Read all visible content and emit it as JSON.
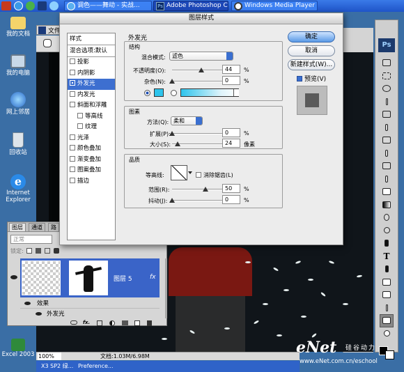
{
  "taskbar": {
    "tabs": [
      {
        "label": "调色——舞动 - 实战..."
      },
      {
        "label": "Adobe Photoshop C..."
      },
      {
        "label": "Windows Media Player"
      }
    ],
    "tray_items": [
      {
        "label": "X3 SP2 绿..."
      },
      {
        "label": "Preference..."
      }
    ]
  },
  "desktop": {
    "icons": [
      {
        "label": "我的文档"
      },
      {
        "label": "我的电脑"
      },
      {
        "label": "网上邻居"
      },
      {
        "label": "回收站"
      },
      {
        "label": "Internet Explorer"
      },
      {
        "label": "Excel 2003"
      }
    ]
  },
  "photoshop": {
    "menu_file": "文件",
    "zoom": "100%",
    "doc_info": "文档:1.03M/6.98M",
    "toolbox_title": "Ps"
  },
  "dialog": {
    "title": "图层样式",
    "styles_panel": {
      "header": "样式",
      "blend_options": "混合选项:默认",
      "items": [
        {
          "label": "投影",
          "checked": false,
          "selected": false,
          "indent": false
        },
        {
          "label": "内阴影",
          "checked": false,
          "selected": false,
          "indent": false
        },
        {
          "label": "外发光",
          "checked": true,
          "selected": true,
          "indent": false
        },
        {
          "label": "内发光",
          "checked": false,
          "selected": false,
          "indent": false
        },
        {
          "label": "斜面和浮雕",
          "checked": false,
          "selected": false,
          "indent": false
        },
        {
          "label": "等高线",
          "checked": false,
          "selected": false,
          "indent": true
        },
        {
          "label": "纹理",
          "checked": false,
          "selected": false,
          "indent": true
        },
        {
          "label": "光泽",
          "checked": false,
          "selected": false,
          "indent": false
        },
        {
          "label": "颜色叠加",
          "checked": false,
          "selected": false,
          "indent": false
        },
        {
          "label": "渐变叠加",
          "checked": false,
          "selected": false,
          "indent": false
        },
        {
          "label": "图案叠加",
          "checked": false,
          "selected": false,
          "indent": false
        },
        {
          "label": "描边",
          "checked": false,
          "selected": false,
          "indent": false
        }
      ]
    },
    "outer_glow": {
      "title": "外发光",
      "structure": {
        "title": "结构",
        "blend_mode_label": "混合模式:",
        "blend_mode_value": "滤色",
        "opacity_label": "不透明度(O):",
        "opacity_value": "44",
        "opacity_unit": "%",
        "noise_label": "杂色(N):",
        "noise_value": "0",
        "noise_unit": "%",
        "glow_color": "#2ec4ec"
      },
      "elements": {
        "title": "图素",
        "technique_label": "方法(Q):",
        "technique_value": "柔和",
        "spread_label": "扩展(P):",
        "spread_value": "0",
        "spread_unit": "%",
        "size_label": "大小(S):",
        "size_value": "24",
        "size_unit": "像素"
      },
      "quality": {
        "title": "品质",
        "contour_label": "等高线:",
        "antialias_label": "消除锯齿(L)",
        "range_label": "范围(R):",
        "range_value": "50",
        "range_unit": "%",
        "jitter_label": "抖动(J):",
        "jitter_value": "0",
        "jitter_unit": "%"
      }
    },
    "buttons": {
      "ok": "确定",
      "cancel": "取消",
      "new_style": "新建样式(W)...",
      "preview": "预览(V)"
    }
  },
  "layers_panel": {
    "tabs": [
      "图层",
      "通道",
      "路"
    ],
    "blend_mode": "正常",
    "lock_label": "锁定:",
    "layer_name": "图层 5",
    "fx_mark": "fx",
    "effects_label": "效果",
    "effect_item": "外发光"
  },
  "watermark": {
    "brand": "eNet",
    "brand_cn": "硅谷动力",
    "url": "www.eNet.com.cn/eschool"
  }
}
